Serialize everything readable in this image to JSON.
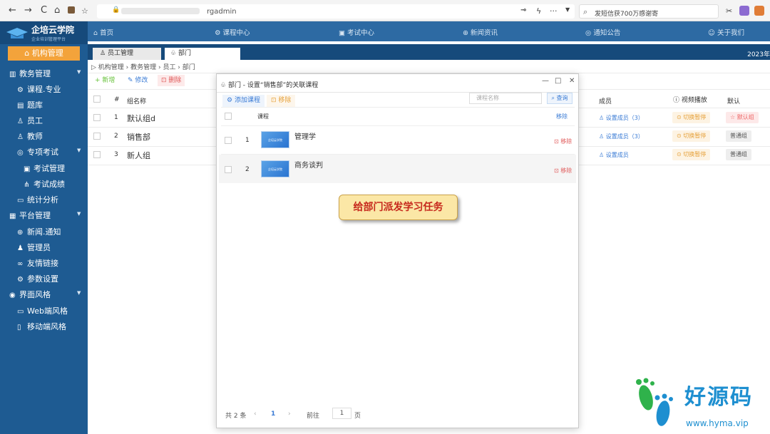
{
  "browser": {
    "back": "←",
    "forward": "→",
    "reload": "C",
    "home": "⌂",
    "url_tail": "rgadmin",
    "search_placeholder": "发短信获700万感谢寄"
  },
  "brand": {
    "title": "企培云学院",
    "subtitle": "企业培训管理平台"
  },
  "topnav": [
    {
      "icon": "home-icon",
      "label": "首页"
    },
    {
      "icon": "course-icon",
      "label": "课程中心"
    },
    {
      "icon": "exam-icon",
      "label": "考试中心"
    },
    {
      "icon": "globe-icon",
      "label": "新闻资讯"
    },
    {
      "icon": "notice-icon",
      "label": "通知公告"
    },
    {
      "icon": "about-icon",
      "label": "关于我们"
    }
  ],
  "sidebar": {
    "org_button": "机构管理",
    "items": [
      {
        "label": "教务管理",
        "level": 0,
        "icon": "bar-chart-icon",
        "caret": true
      },
      {
        "label": "课程.专业",
        "level": 1,
        "icon": "course-icon"
      },
      {
        "label": "题库",
        "level": 1,
        "icon": "question-bank-icon"
      },
      {
        "label": "员工",
        "level": 1,
        "icon": "user-icon"
      },
      {
        "label": "教师",
        "level": 1,
        "icon": "teacher-icon"
      },
      {
        "label": "专项考试",
        "level": 1,
        "icon": "exam-target-icon",
        "caret": true
      },
      {
        "label": "考试管理",
        "level": 2,
        "icon": "exam-manage-icon"
      },
      {
        "label": "考试成绩",
        "level": 2,
        "icon": "score-icon"
      },
      {
        "label": "统计分析",
        "level": 1,
        "icon": "stats-icon"
      },
      {
        "label": "平台管理",
        "level": 0,
        "icon": "platform-icon",
        "caret": true
      },
      {
        "label": "新闻.通知",
        "level": 1,
        "icon": "news-icon"
      },
      {
        "label": "管理员",
        "level": 1,
        "icon": "admin-icon"
      },
      {
        "label": "友情链接",
        "level": 1,
        "icon": "link-icon"
      },
      {
        "label": "参数设置",
        "level": 1,
        "icon": "settings-icon"
      },
      {
        "label": "界面风格",
        "level": 0,
        "icon": "theme-icon",
        "caret": true
      },
      {
        "label": "Web端风格",
        "level": 1,
        "icon": "monitor-icon"
      },
      {
        "label": "移动端风格",
        "level": 1,
        "icon": "mobile-icon"
      }
    ]
  },
  "tabs": [
    {
      "label": "员工管理",
      "icon": "user-icon"
    },
    {
      "label": "部门",
      "icon": "group-icon"
    }
  ],
  "tabs_right_text": "2023年",
  "breadcrumb": "机构管理 › 教务管理 › 员工 › 部门",
  "toolbar": {
    "new": "新增",
    "edit": "修改",
    "delete": "删除"
  },
  "table": {
    "headers": {
      "index": "#",
      "name": "组名称",
      "members": "成员",
      "video": "视频播放",
      "default": "默认"
    },
    "rows": [
      {
        "index": "1",
        "name": "默认组d",
        "members": "设置成员（3）",
        "video": "切换暂停",
        "default": "默认组"
      },
      {
        "index": "2",
        "name": "销售部",
        "members": "设置成员（3）",
        "video": "切换暂停",
        "default": "普通组"
      },
      {
        "index": "3",
        "name": "新人组",
        "members": "设置成员",
        "video": "切换暂停",
        "default": "普通组"
      }
    ]
  },
  "modal": {
    "title": "部门 - 设置“销售部”的关联课程",
    "add_course": "添加课程",
    "remove": "移除",
    "search_placeholder": "课程名称",
    "query": "查询",
    "col_course": "课程",
    "col_action": "移除",
    "rows": [
      {
        "index": "1",
        "name": "管理学",
        "action": "移除",
        "thumb_text": "企培云学院"
      },
      {
        "index": "2",
        "name": "商务谈判",
        "action": "移除",
        "thumb_text": "企培云学院"
      }
    ],
    "pager": {
      "total": "共 2 条",
      "prev": "‹",
      "current": "1",
      "next": "›",
      "goto": "前往",
      "page_value": "1",
      "page_unit": "页"
    }
  },
  "annotation": "给部门派发学习任务",
  "watermark": {
    "text": "好源码",
    "url": "www.hyma.vip"
  },
  "colors": {
    "sidebar": "#1e5b92",
    "topnav": "#2d6aa3",
    "accent": "#f3a33b",
    "annotation_text": "#c6281c"
  }
}
